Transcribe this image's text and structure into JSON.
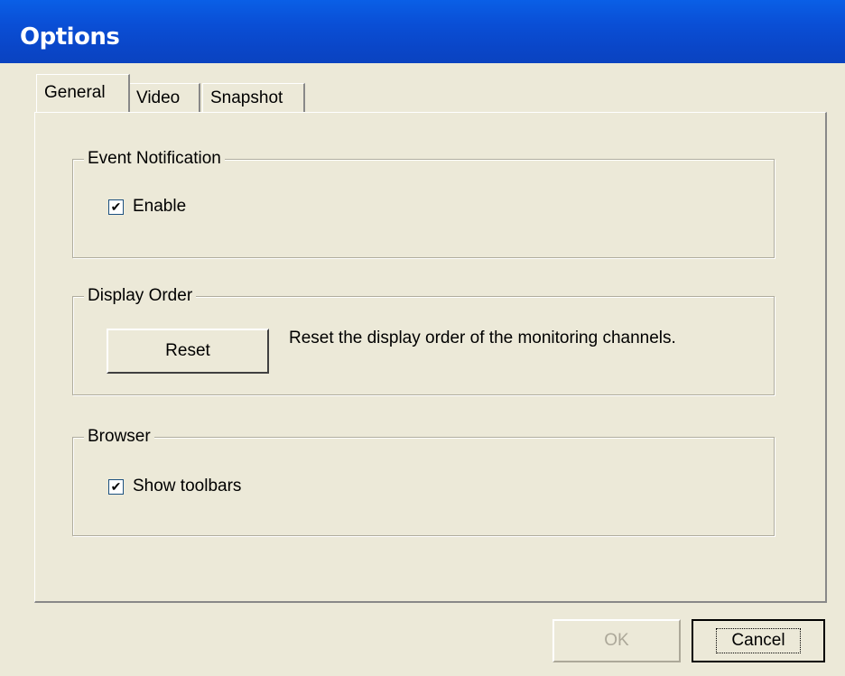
{
  "window": {
    "title": "Options"
  },
  "tabs": [
    {
      "label": "General",
      "active": true
    },
    {
      "label": "Video",
      "active": false
    },
    {
      "label": "Snapshot",
      "active": false
    }
  ],
  "groups": {
    "event_notification": {
      "title": "Event Notification",
      "enable": {
        "label": "Enable",
        "checked": true
      }
    },
    "display_order": {
      "title": "Display Order",
      "reset_button": "Reset",
      "description": "Reset the display order of the monitoring channels."
    },
    "browser": {
      "title": "Browser",
      "show_toolbars": {
        "label": "Show toolbars",
        "checked": true
      }
    }
  },
  "footer": {
    "ok_label": "OK",
    "cancel_label": "Cancel"
  },
  "colors": {
    "titlebar": "#0a4fd6",
    "dialog_bg": "#ece9d8",
    "checkbox_border": "#1c5180"
  }
}
